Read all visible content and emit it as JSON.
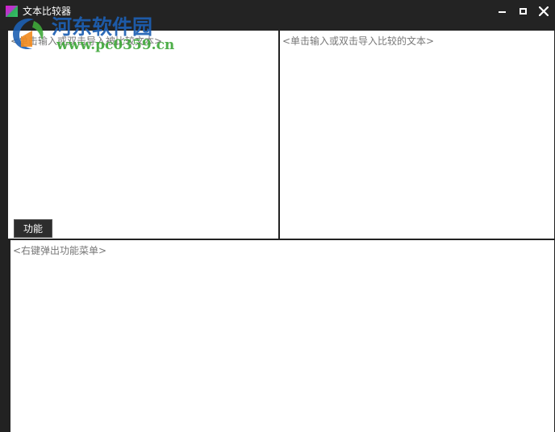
{
  "window": {
    "title": "文本比较器",
    "icon": "app-icon",
    "controls": [
      "minimize-icon",
      "maximize-icon",
      "close-icon"
    ]
  },
  "watermark": {
    "site_name": "河东软件园",
    "url": "www.pc0359.cn"
  },
  "left_pane": {
    "placeholder": "<单击输入或双击导入被比较文本>"
  },
  "right_pane": {
    "placeholder": "<单击输入或双击导入比较的文本>"
  },
  "function_button": {
    "label": "功能"
  },
  "result_pane": {
    "placeholder": "<右键弹出功能菜单>"
  },
  "colors": {
    "background": "#222222",
    "pane": "#ffffff",
    "placeholder_text": "#777777",
    "watermark_blue": "#1d5fb3",
    "watermark_green": "#3fa83a"
  }
}
